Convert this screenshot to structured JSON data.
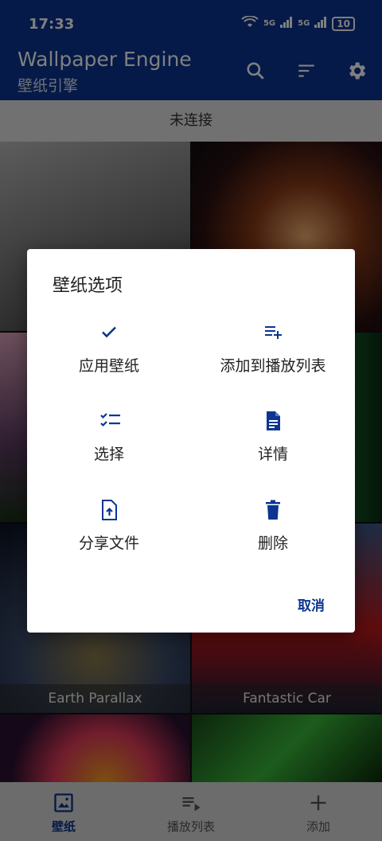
{
  "status": {
    "time": "17:33",
    "net1": "5G",
    "net2": "5G",
    "battery": "10"
  },
  "app_bar": {
    "title": "Wallpaper Engine",
    "subtitle": "壁纸引擎"
  },
  "connection": {
    "text": "未连接"
  },
  "wallpapers": [
    {
      "label": ""
    },
    {
      "label": ""
    },
    {
      "label": ""
    },
    {
      "label": ""
    },
    {
      "label": "Earth Parallax"
    },
    {
      "label": "Fantastic Car"
    },
    {
      "label": ""
    },
    {
      "label": ""
    }
  ],
  "dialog": {
    "title": "壁纸选项",
    "options": [
      {
        "label": "应用壁纸",
        "icon": "check-icon"
      },
      {
        "label": "添加到播放列表",
        "icon": "playlist-add-icon"
      },
      {
        "label": "选择",
        "icon": "checklist-icon"
      },
      {
        "label": "详情",
        "icon": "document-icon"
      },
      {
        "label": "分享文件",
        "icon": "share-file-icon"
      },
      {
        "label": "删除",
        "icon": "trash-icon"
      }
    ],
    "cancel_label": "取消"
  },
  "bottom_nav": {
    "items": [
      {
        "label": "壁纸",
        "icon": "wallpaper-icon",
        "active": true
      },
      {
        "label": "播放列表",
        "icon": "playlist-icon",
        "active": false
      },
      {
        "label": "添加",
        "icon": "add-icon",
        "active": false
      }
    ]
  },
  "colors": {
    "primary": "#0b3590",
    "accent": "#0b3590",
    "dialog_bg": "#ffffff"
  }
}
